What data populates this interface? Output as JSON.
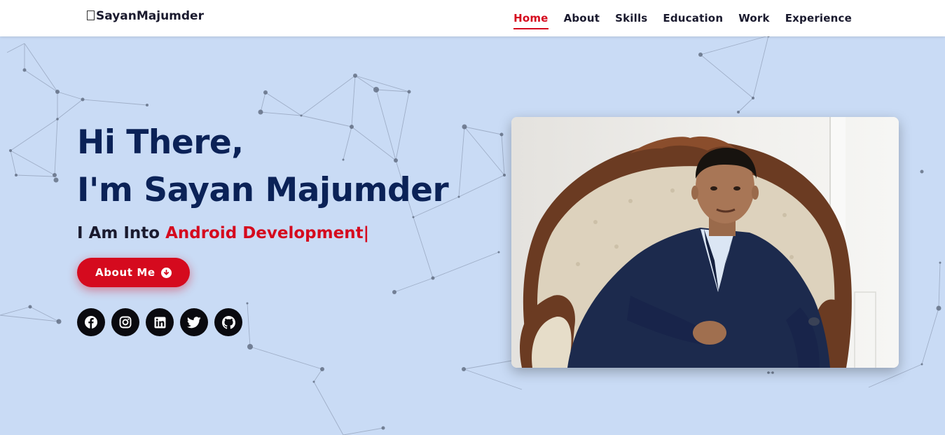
{
  "header": {
    "logo_text": "SayanMajumder",
    "nav": [
      {
        "label": "Home",
        "active": true
      },
      {
        "label": "About",
        "active": false
      },
      {
        "label": "Skills",
        "active": false
      },
      {
        "label": "Education",
        "active": false
      },
      {
        "label": "Work",
        "active": false
      },
      {
        "label": "Experience",
        "active": false
      }
    ]
  },
  "hero": {
    "line1": "Hi There,",
    "line2": "I'm Sayan Majumder",
    "tagline_prefix": "I Am Into ",
    "tagline_highlight": "Android Development|",
    "button_label": "About Me",
    "button_icon": "arrow-circle-down-icon",
    "socials": [
      "facebook-icon",
      "instagram-icon",
      "linkedin-icon",
      "twitter-icon",
      "github-icon"
    ]
  },
  "colors": {
    "accent": "#d50a1e",
    "heading": "#0b2257",
    "background": "#c9dbf5",
    "social_bg": "#0a0a0f"
  }
}
